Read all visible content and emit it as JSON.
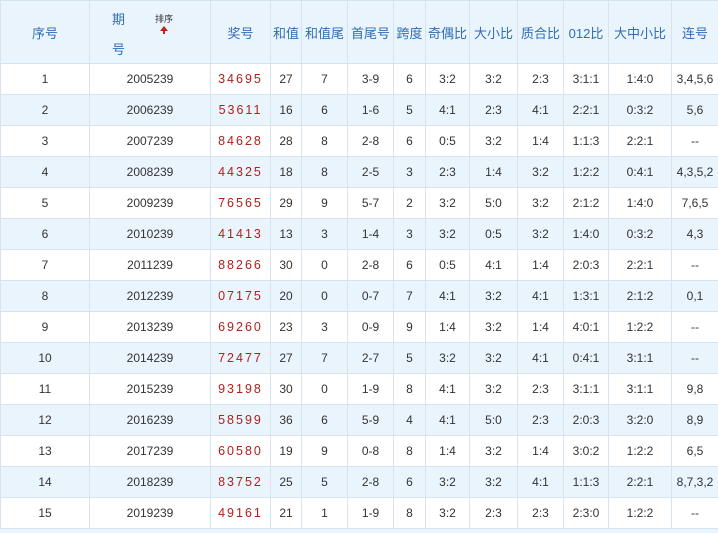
{
  "headers": {
    "seq": "序号",
    "issue_line1": "期",
    "issue_line2": "号",
    "sort_label": "排序",
    "award": "奖号",
    "sum": "和值",
    "sum_tail": "和值尾",
    "first_last": "首尾号",
    "span": "跨度",
    "odd_even": "奇偶比",
    "big_small": "大小比",
    "prime_comp": "质合比",
    "mod012": "012比",
    "big_mid_small": "大中小比",
    "consecutive": "连号"
  },
  "rows": [
    {
      "seq": "1",
      "issue": "2005239",
      "award": "34695",
      "sum": "27",
      "sum_tail": "7",
      "first_last": "3-9",
      "span": "6",
      "odd_even": "3:2",
      "big_small": "3:2",
      "prime_comp": "2:3",
      "mod012": "3:1:1",
      "bms": "1:4:0",
      "consec": "3,4,5,6"
    },
    {
      "seq": "2",
      "issue": "2006239",
      "award": "53611",
      "sum": "16",
      "sum_tail": "6",
      "first_last": "1-6",
      "span": "5",
      "odd_even": "4:1",
      "big_small": "2:3",
      "prime_comp": "4:1",
      "mod012": "2:2:1",
      "bms": "0:3:2",
      "consec": "5,6"
    },
    {
      "seq": "3",
      "issue": "2007239",
      "award": "84628",
      "sum": "28",
      "sum_tail": "8",
      "first_last": "2-8",
      "span": "6",
      "odd_even": "0:5",
      "big_small": "3:2",
      "prime_comp": "1:4",
      "mod012": "1:1:3",
      "bms": "2:2:1",
      "consec": "--"
    },
    {
      "seq": "4",
      "issue": "2008239",
      "award": "44325",
      "sum": "18",
      "sum_tail": "8",
      "first_last": "2-5",
      "span": "3",
      "odd_even": "2:3",
      "big_small": "1:4",
      "prime_comp": "3:2",
      "mod012": "1:2:2",
      "bms": "0:4:1",
      "consec": "4,3,5,2"
    },
    {
      "seq": "5",
      "issue": "2009239",
      "award": "76565",
      "sum": "29",
      "sum_tail": "9",
      "first_last": "5-7",
      "span": "2",
      "odd_even": "3:2",
      "big_small": "5:0",
      "prime_comp": "3:2",
      "mod012": "2:1:2",
      "bms": "1:4:0",
      "consec": "7,6,5"
    },
    {
      "seq": "6",
      "issue": "2010239",
      "award": "41413",
      "sum": "13",
      "sum_tail": "3",
      "first_last": "1-4",
      "span": "3",
      "odd_even": "3:2",
      "big_small": "0:5",
      "prime_comp": "3:2",
      "mod012": "1:4:0",
      "bms": "0:3:2",
      "consec": "4,3"
    },
    {
      "seq": "7",
      "issue": "2011239",
      "award": "88266",
      "sum": "30",
      "sum_tail": "0",
      "first_last": "2-8",
      "span": "6",
      "odd_even": "0:5",
      "big_small": "4:1",
      "prime_comp": "1:4",
      "mod012": "2:0:3",
      "bms": "2:2:1",
      "consec": "--"
    },
    {
      "seq": "8",
      "issue": "2012239",
      "award": "07175",
      "sum": "20",
      "sum_tail": "0",
      "first_last": "0-7",
      "span": "7",
      "odd_even": "4:1",
      "big_small": "3:2",
      "prime_comp": "4:1",
      "mod012": "1:3:1",
      "bms": "2:1:2",
      "consec": "0,1"
    },
    {
      "seq": "9",
      "issue": "2013239",
      "award": "69260",
      "sum": "23",
      "sum_tail": "3",
      "first_last": "0-9",
      "span": "9",
      "odd_even": "1:4",
      "big_small": "3:2",
      "prime_comp": "1:4",
      "mod012": "4:0:1",
      "bms": "1:2:2",
      "consec": "--"
    },
    {
      "seq": "10",
      "issue": "2014239",
      "award": "72477",
      "sum": "27",
      "sum_tail": "7",
      "first_last": "2-7",
      "span": "5",
      "odd_even": "3:2",
      "big_small": "3:2",
      "prime_comp": "4:1",
      "mod012": "0:4:1",
      "bms": "3:1:1",
      "consec": "--"
    },
    {
      "seq": "11",
      "issue": "2015239",
      "award": "93198",
      "sum": "30",
      "sum_tail": "0",
      "first_last": "1-9",
      "span": "8",
      "odd_even": "4:1",
      "big_small": "3:2",
      "prime_comp": "2:3",
      "mod012": "3:1:1",
      "bms": "3:1:1",
      "consec": "9,8"
    },
    {
      "seq": "12",
      "issue": "2016239",
      "award": "58599",
      "sum": "36",
      "sum_tail": "6",
      "first_last": "5-9",
      "span": "4",
      "odd_even": "4:1",
      "big_small": "5:0",
      "prime_comp": "2:3",
      "mod012": "2:0:3",
      "bms": "3:2:0",
      "consec": "8,9"
    },
    {
      "seq": "13",
      "issue": "2017239",
      "award": "60580",
      "sum": "19",
      "sum_tail": "9",
      "first_last": "0-8",
      "span": "8",
      "odd_even": "1:4",
      "big_small": "3:2",
      "prime_comp": "1:4",
      "mod012": "3:0:2",
      "bms": "1:2:2",
      "consec": "6,5"
    },
    {
      "seq": "14",
      "issue": "2018239",
      "award": "83752",
      "sum": "25",
      "sum_tail": "5",
      "first_last": "2-8",
      "span": "6",
      "odd_even": "3:2",
      "big_small": "3:2",
      "prime_comp": "4:1",
      "mod012": "1:1:3",
      "bms": "2:2:1",
      "consec": "8,7,3,2"
    },
    {
      "seq": "15",
      "issue": "2019239",
      "award": "49161",
      "sum": "21",
      "sum_tail": "1",
      "first_last": "1-9",
      "span": "8",
      "odd_even": "3:2",
      "big_small": "2:3",
      "prime_comp": "2:3",
      "mod012": "2:3:0",
      "bms": "1:2:2",
      "consec": "--"
    }
  ],
  "colors": {
    "header_bg": "#eaf4fd",
    "header_text": "#2f6db5",
    "award_text": "#b0201b",
    "row_alt_bg": "#eaf4fd",
    "border": "#d6e4f0"
  }
}
